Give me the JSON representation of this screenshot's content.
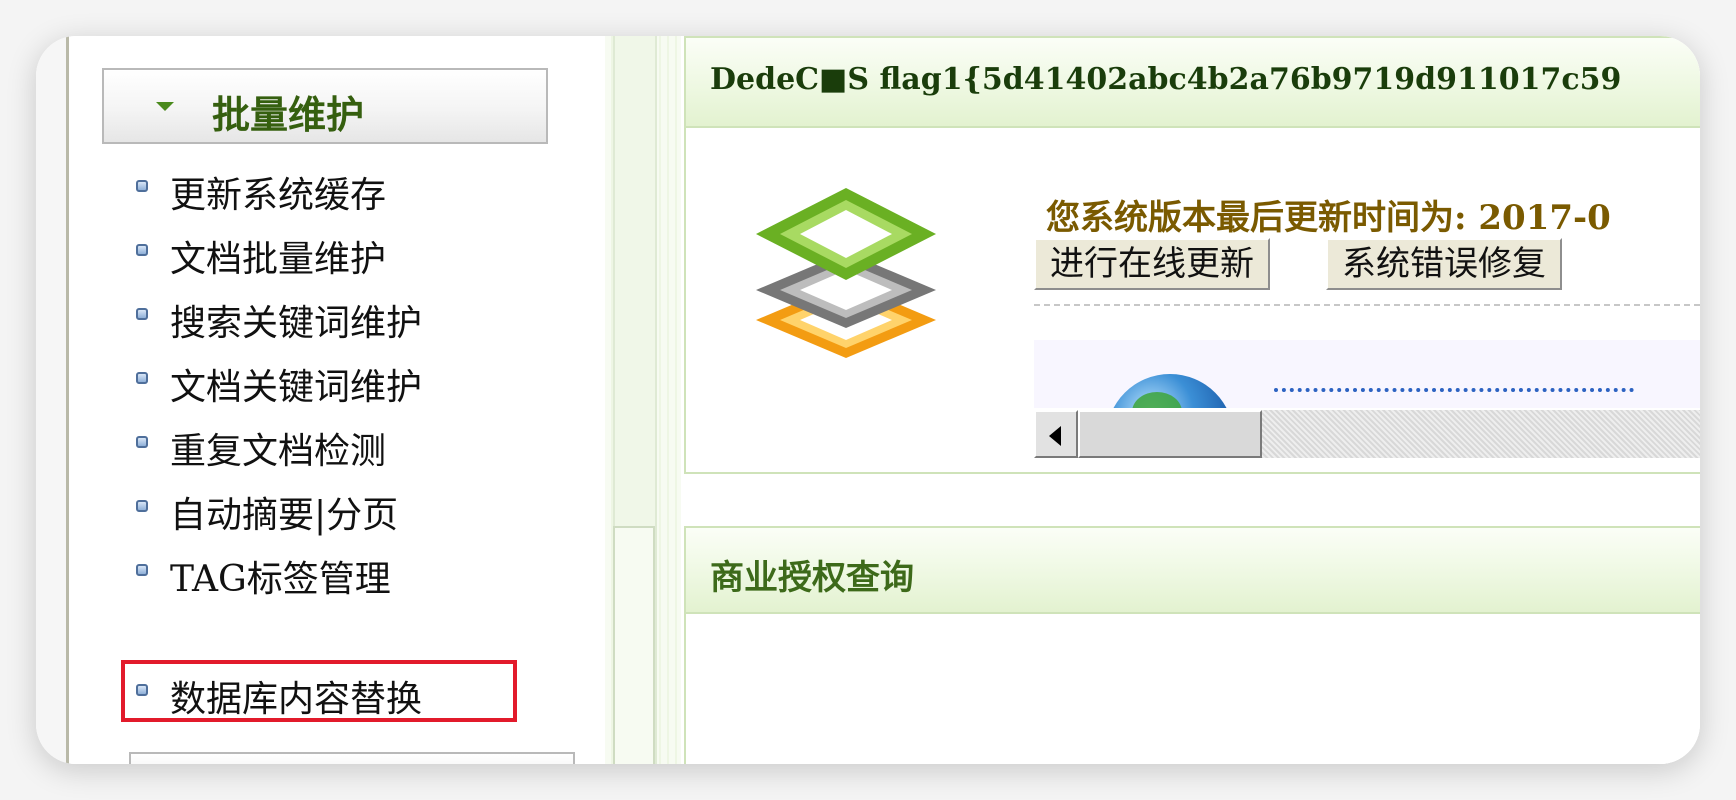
{
  "sidebar": {
    "section_title": "批量维护",
    "items": [
      {
        "label": "更新系统缓存"
      },
      {
        "label": "文档批量维护"
      },
      {
        "label": "搜索关键词维护"
      },
      {
        "label": "文档关键词维护"
      },
      {
        "label": "重复文档检测"
      },
      {
        "label": "自动摘要|分页"
      },
      {
        "label": "TAG标签管理"
      },
      {
        "label": "数据库内容替换"
      }
    ],
    "highlighted_item": "数据库内容替换"
  },
  "main": {
    "info_panel": {
      "title": "DedeC■S flag1{5d41402abc4b2a76b9719d911017c59",
      "version_text": "您系统版本最后更新时间为: 2017-0",
      "online_update_button": "进行在线更新",
      "error_repair_button": "系统错误修复"
    },
    "license_panel": {
      "title": "商业授权查询"
    }
  },
  "colors": {
    "sidebar_title": "#355f0f",
    "panel_title_bar": "#eef8e2",
    "version_text": "#7a5a00",
    "highlight_border": "#e21a2b"
  },
  "icons": [
    "caret-down-icon",
    "bullet-icon",
    "dede-logo-icon",
    "globe-icon",
    "scroll-left-arrow-icon"
  ]
}
